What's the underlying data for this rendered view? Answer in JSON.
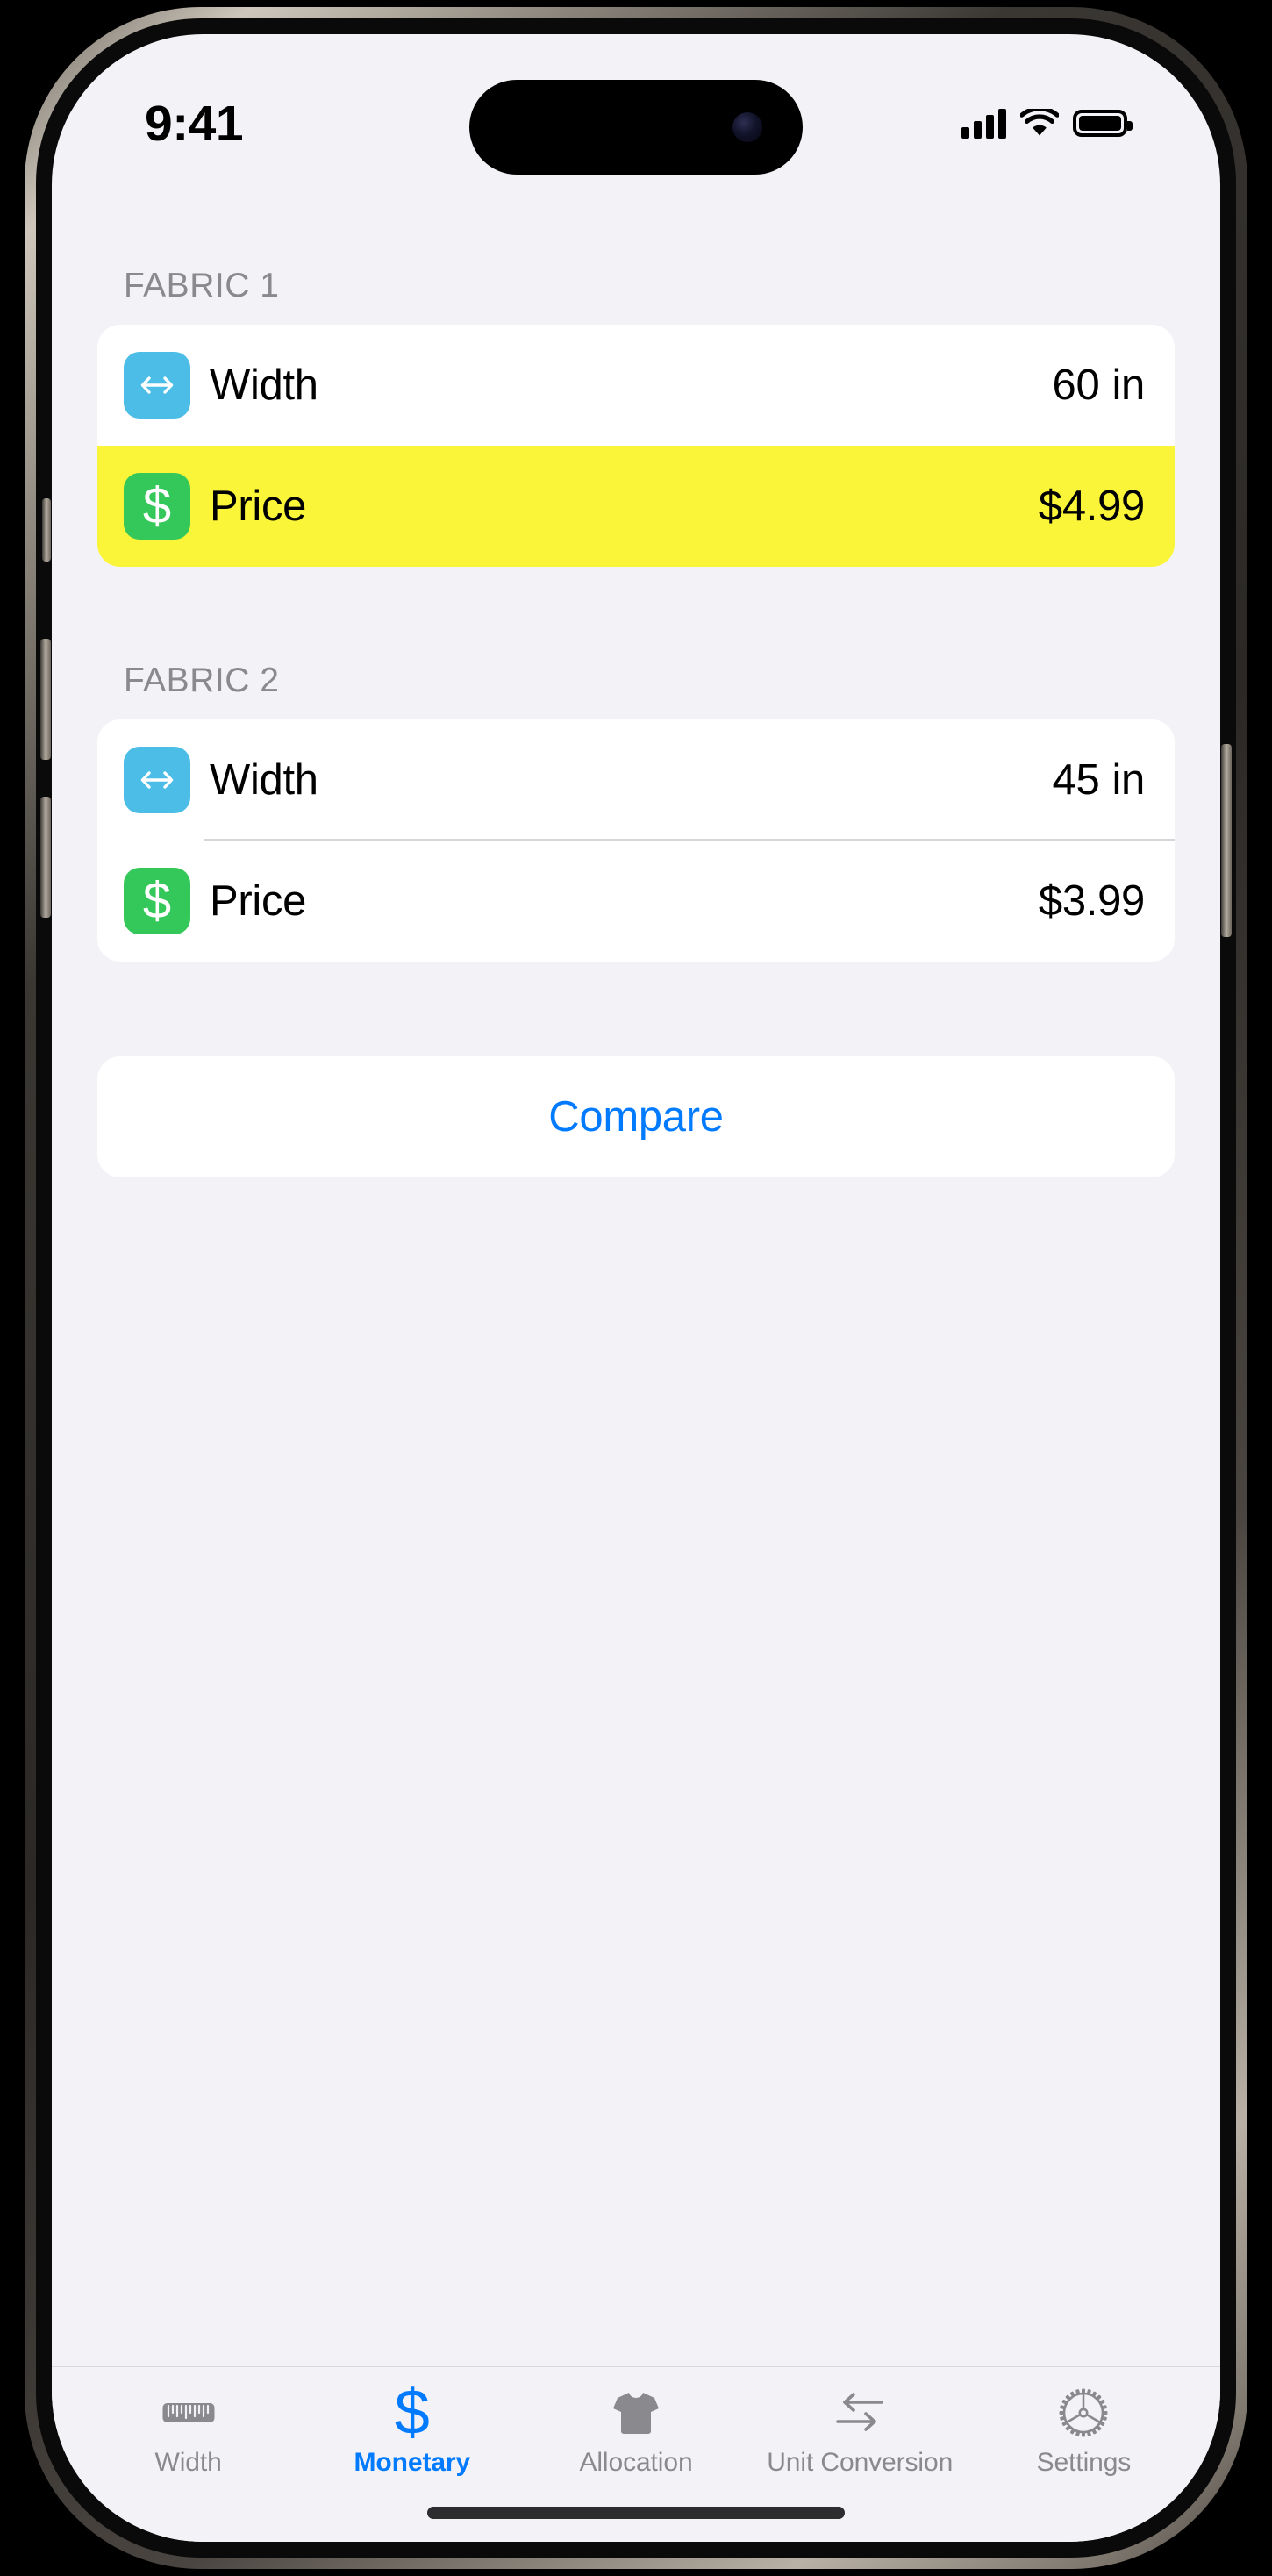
{
  "status_bar": {
    "time": "9:41",
    "signal_icon": "cellular-bars-icon",
    "wifi_icon": "wifi-icon",
    "battery_icon": "battery-full-icon"
  },
  "sections": [
    {
      "header": "FABRIC 1",
      "rows": [
        {
          "icon": "width-arrows-icon",
          "icon_color": "#4CBDE6",
          "label": "Width",
          "value": "60",
          "unit": "in",
          "highlighted": false
        },
        {
          "icon": "dollar-sign-icon",
          "icon_color": "#34C759",
          "label": "Price",
          "value": "$4.99",
          "unit": "",
          "highlighted": true
        }
      ]
    },
    {
      "header": "FABRIC 2",
      "rows": [
        {
          "icon": "width-arrows-icon",
          "icon_color": "#4CBDE6",
          "label": "Width",
          "value": "45",
          "unit": "in",
          "highlighted": false
        },
        {
          "icon": "dollar-sign-icon",
          "icon_color": "#34C759",
          "label": "Price",
          "value": "$3.99",
          "unit": "",
          "highlighted": false
        }
      ]
    }
  ],
  "compare_button": {
    "label": "Compare",
    "color": "#007AFF"
  },
  "tab_bar": {
    "active_color": "#007AFF",
    "inactive_color": "#8A8A8E",
    "items": [
      {
        "label": "Width",
        "icon": "ruler-icon",
        "active": false
      },
      {
        "label": "Monetary",
        "icon": "dollar-sign-icon",
        "active": true
      },
      {
        "label": "Allocation",
        "icon": "tshirt-icon",
        "active": false
      },
      {
        "label": "Unit Conversion",
        "icon": "swap-arrows-icon",
        "active": false
      },
      {
        "label": "Settings",
        "icon": "gear-icon",
        "active": false
      }
    ]
  },
  "highlight_color": "#FAF538"
}
